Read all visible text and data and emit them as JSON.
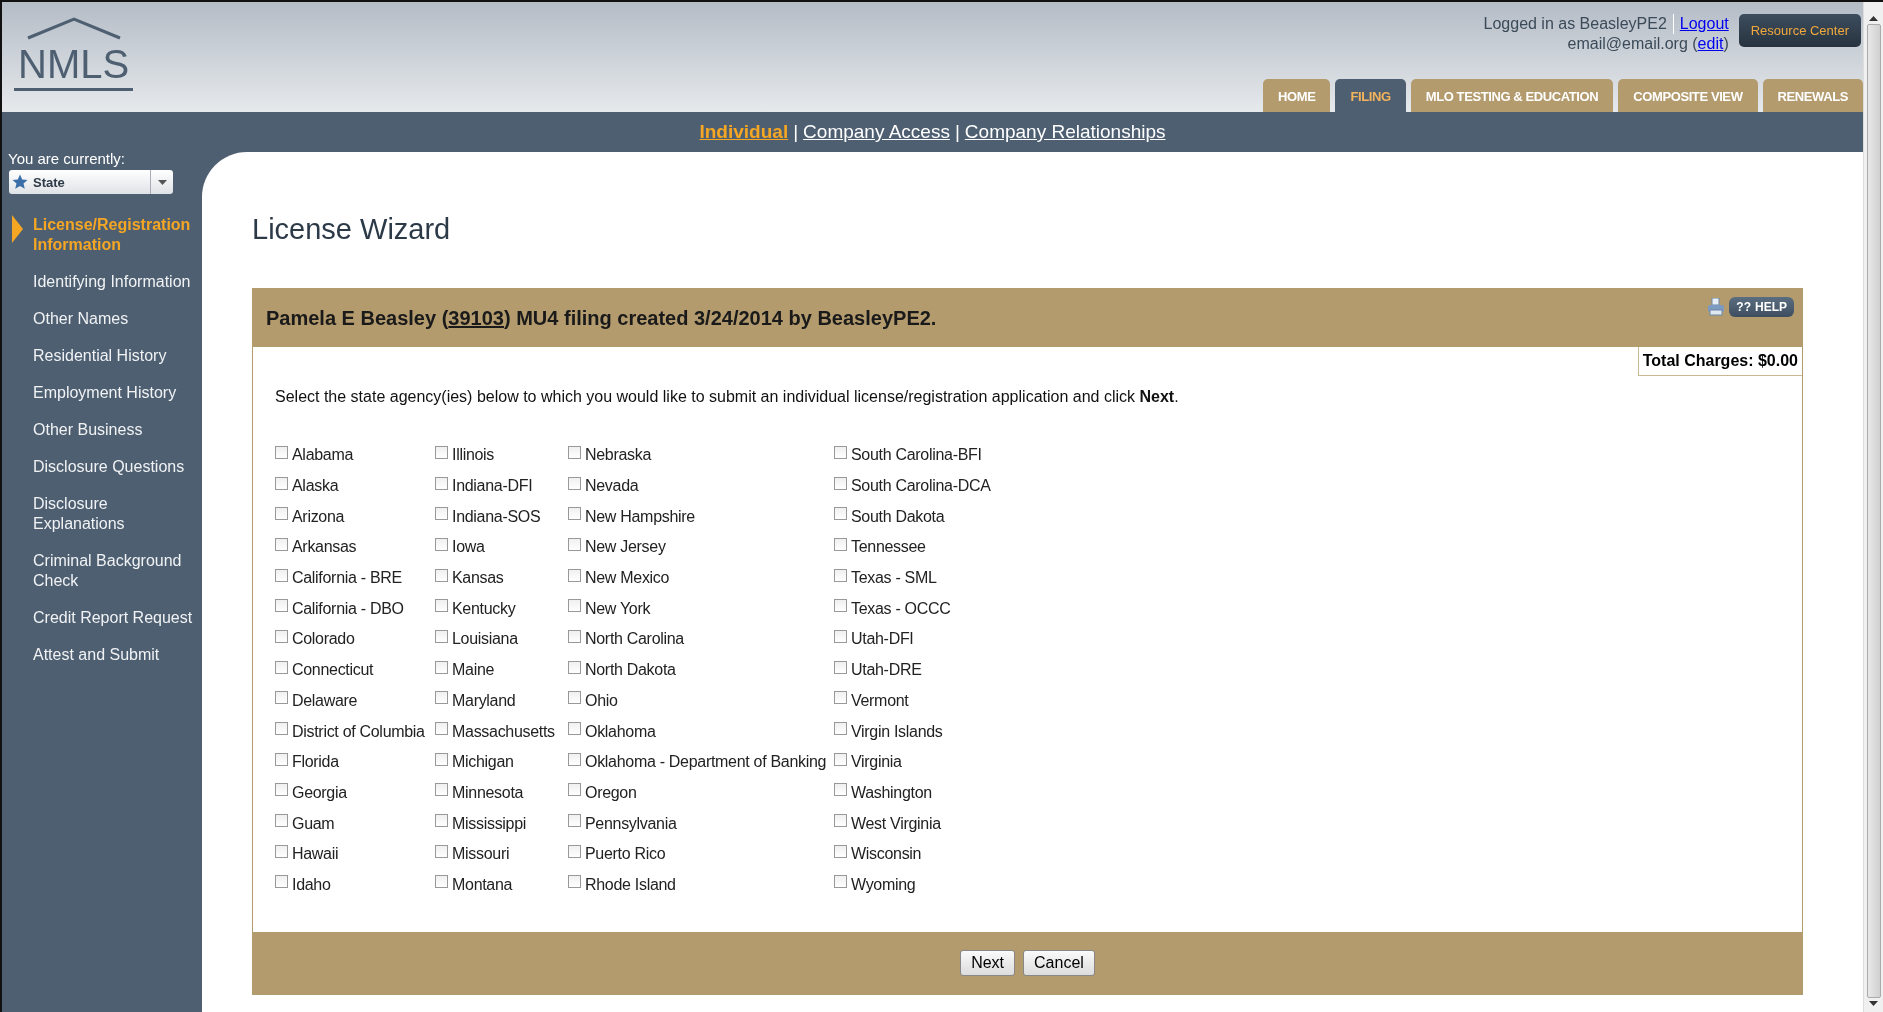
{
  "header": {
    "logo_text": "NMLS",
    "logged_in": "Logged in as BeasleyPE2",
    "logout_link": "Logout",
    "email_prefix": "email@email.org (",
    "edit_link": "edit",
    "email_suffix": ")",
    "resource_button": "Resource Center",
    "tabs": [
      {
        "label": "HOME",
        "selected": false
      },
      {
        "label": "FILING",
        "selected": true
      },
      {
        "label": "MLO TESTING & EDUCATION",
        "selected": false
      },
      {
        "label": "COMPOSITE VIEW",
        "selected": false
      },
      {
        "label": "RENEWALS",
        "selected": false
      }
    ]
  },
  "subnav": [
    {
      "kind": "link",
      "label": "Individual",
      "selected": true
    },
    {
      "kind": "separator",
      "label": "|"
    },
    {
      "kind": "link",
      "label": "Company Access",
      "selected": false
    },
    {
      "kind": "separator",
      "label": "|"
    },
    {
      "kind": "link",
      "label": "Company Relationships",
      "selected": false
    }
  ],
  "sidebar": {
    "current_label": "You are currently:",
    "role_select": "State",
    "items": [
      {
        "label": "License/Registration Information",
        "selected": true
      },
      {
        "label": "Identifying Information",
        "selected": false
      },
      {
        "label": "Other Names",
        "selected": false
      },
      {
        "label": "Residential History",
        "selected": false
      },
      {
        "label": "Employment History",
        "selected": false
      },
      {
        "label": "Other Business",
        "selected": false
      },
      {
        "label": "Disclosure Questions",
        "selected": false
      },
      {
        "label": "Disclosure Explanations",
        "selected": false
      },
      {
        "label": "Criminal Background Check",
        "selected": false
      },
      {
        "label": "Credit Report Request",
        "selected": false
      },
      {
        "label": "Attest and Submit",
        "selected": false
      }
    ]
  },
  "page_title": "License Wizard",
  "card": {
    "title_prefix": "Pamela E Beasley (",
    "id_link": "39103",
    "title_suffix": ") MU4 filing created 3/24/2014 by BeasleyPE2.",
    "help_icon_text": "??",
    "help_label": "HELP",
    "total_charges": "Total Charges: $0.00",
    "instruction": "Select the state agency(ies) below to which you would like to submit an individual license/registration application and click **Next**.",
    "agency_columns": [
      {
        "items": [
          {
            "label": "Alabama",
            "checked": false
          },
          {
            "label": "Alaska",
            "checked": false
          },
          {
            "label": "Arizona",
            "checked": false
          },
          {
            "label": "Arkansas",
            "checked": false
          },
          {
            "label": "California - BRE",
            "checked": false
          },
          {
            "label": "California - DBO",
            "checked": false
          },
          {
            "label": "Colorado",
            "checked": false
          },
          {
            "label": "Connecticut",
            "checked": false
          },
          {
            "label": "Delaware",
            "checked": false
          },
          {
            "label": "District of Columbia",
            "checked": false
          },
          {
            "label": "Florida",
            "checked": false
          },
          {
            "label": "Georgia",
            "checked": false
          },
          {
            "label": "Guam",
            "checked": false
          },
          {
            "label": "Hawaii",
            "checked": false
          },
          {
            "label": "Idaho",
            "checked": false
          }
        ]
      },
      {
        "items": [
          {
            "label": "Illinois",
            "checked": false
          },
          {
            "label": "Indiana-DFI",
            "checked": false
          },
          {
            "label": "Indiana-SOS",
            "checked": false
          },
          {
            "label": "Iowa",
            "checked": false
          },
          {
            "label": "Kansas",
            "checked": false
          },
          {
            "label": "Kentucky",
            "checked": false
          },
          {
            "label": "Louisiana",
            "checked": false
          },
          {
            "label": "Maine",
            "checked": false
          },
          {
            "label": "Maryland",
            "checked": false
          },
          {
            "label": "Massachusetts",
            "checked": false
          },
          {
            "label": "Michigan",
            "checked": false
          },
          {
            "label": "Minnesota",
            "checked": false
          },
          {
            "label": "Mississippi",
            "checked": false
          },
          {
            "label": "Missouri",
            "checked": false
          },
          {
            "label": "Montana",
            "checked": false
          }
        ]
      },
      {
        "items": [
          {
            "label": "Nebraska",
            "checked": false
          },
          {
            "label": "Nevada",
            "checked": false
          },
          {
            "label": "New Hampshire",
            "checked": false
          },
          {
            "label": "New Jersey",
            "checked": false
          },
          {
            "label": "New Mexico",
            "checked": false
          },
          {
            "label": "New York",
            "checked": false
          },
          {
            "label": "North Carolina",
            "checked": false
          },
          {
            "label": "North Dakota",
            "checked": false
          },
          {
            "label": "Ohio",
            "checked": false
          },
          {
            "label": "Oklahoma",
            "checked": false
          },
          {
            "label": "Oklahoma - Department of Banking",
            "checked": false
          },
          {
            "label": "Oregon",
            "checked": false
          },
          {
            "label": "Pennsylvania",
            "checked": false
          },
          {
            "label": "Puerto Rico",
            "checked": false
          },
          {
            "label": "Rhode Island",
            "checked": false
          }
        ]
      },
      {
        "items": [
          {
            "label": "South Carolina-BFI",
            "checked": false
          },
          {
            "label": "South Carolina-DCA",
            "checked": false
          },
          {
            "label": "South Dakota",
            "checked": false
          },
          {
            "label": "Tennessee",
            "checked": false
          },
          {
            "label": "Texas - SML",
            "checked": false
          },
          {
            "label": "Texas - OCCC",
            "checked": false
          },
          {
            "label": "Utah-DFI",
            "checked": false
          },
          {
            "label": "Utah-DRE",
            "checked": false
          },
          {
            "label": "Vermont",
            "checked": false
          },
          {
            "label": "Virgin Islands",
            "checked": false
          },
          {
            "label": "Virginia",
            "checked": false
          },
          {
            "label": "Washington",
            "checked": false
          },
          {
            "label": "West Virginia",
            "checked": false
          },
          {
            "label": "Wisconsin",
            "checked": false
          },
          {
            "label": "Wyoming",
            "checked": false
          }
        ]
      }
    ],
    "buttons": [
      "Next",
      "Cancel"
    ]
  }
}
